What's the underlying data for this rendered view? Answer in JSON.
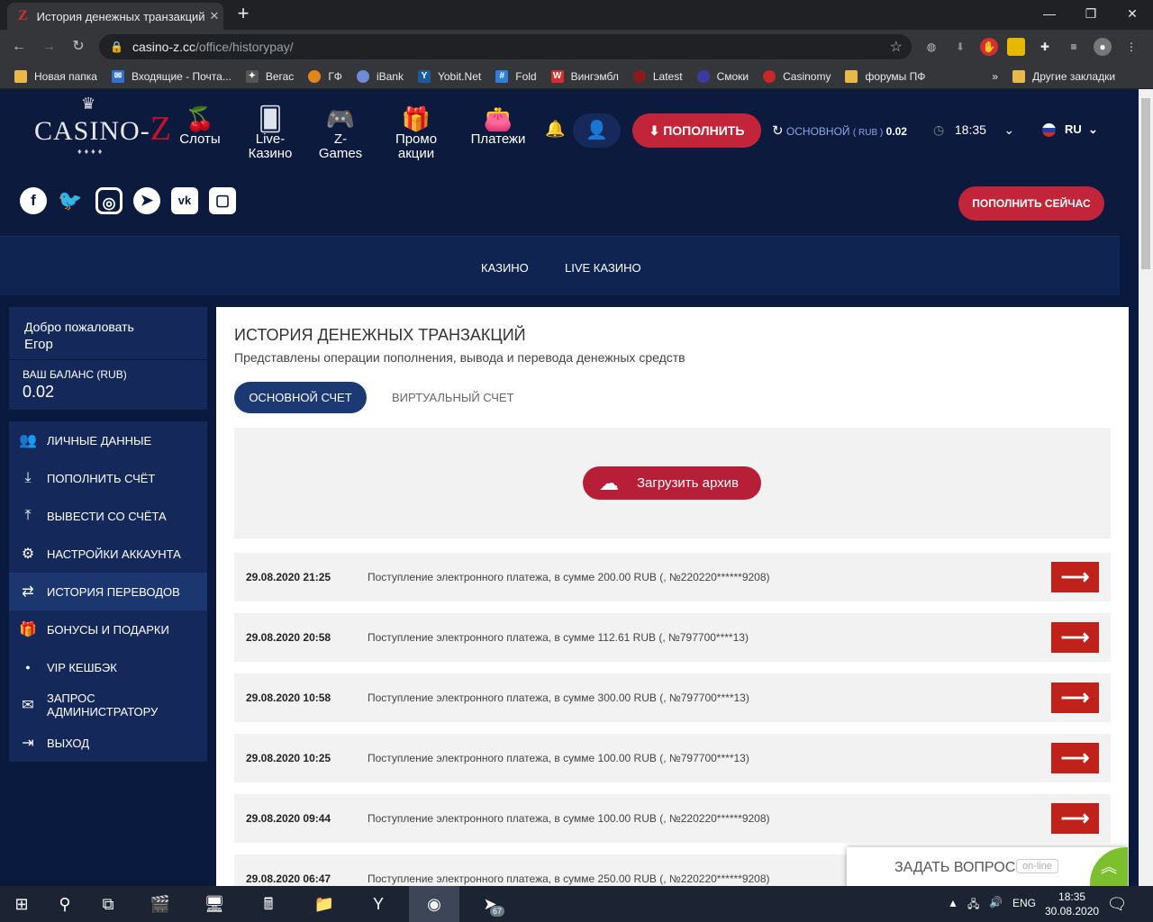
{
  "browser": {
    "tab_title": "История денежных транзакций",
    "tab_favicon": "Z",
    "url_host": "casino-z.cc",
    "url_path": "/office/historypay/",
    "bookmarks": [
      "Новая папка",
      "Входящие - Почта...",
      "Вегас",
      "ГФ",
      "iBank",
      "Yobit.Net",
      "Fold",
      "Вингэмбл",
      "Latest",
      "Смоки",
      "Casinomy",
      "форумы ПФ"
    ],
    "bookmarks_more": "»",
    "other_bookmarks": "Другие закладки"
  },
  "header": {
    "logo_text_left": "CASINO",
    "logo_text_z": "Z",
    "nav": [
      {
        "label": "Слоты",
        "icon": "cherry-icon"
      },
      {
        "label": "Live-\nКазино",
        "icon": "cards-icon"
      },
      {
        "label": "Z-\nGames",
        "icon": "gamepad-icon"
      },
      {
        "label": "Промо\nакции",
        "icon": "gift-icon"
      },
      {
        "label": "Платежи",
        "icon": "wallet-icon"
      }
    ],
    "deposit_label": "ПОПОЛНИТЬ",
    "balance_label": "ОСНОВНОЙ",
    "balance_currency": "( RUB )",
    "balance_value": "0.02",
    "time": "18:35",
    "language": "RU"
  },
  "social": {
    "icons": [
      "facebook-icon",
      "twitter-icon",
      "instagram-icon",
      "telegram-icon",
      "vk-icon",
      "chat-bubble-icon"
    ],
    "deposit_now_label": "ПОПОЛНИТЬ СЕЙЧАС"
  },
  "game_nav": [
    "КАЗИНО",
    "LIVE КАЗИНО"
  ],
  "sidebar": {
    "welcome": "Добро пожаловать",
    "username": "Егор",
    "balance_label": "ВАШ БАЛАНС (RUB)",
    "balance_value": "0.02",
    "menu": [
      {
        "label": "ЛИЧНЫЕ ДАННЫЕ",
        "icon": "user-plus-icon"
      },
      {
        "label": "ПОПОЛНИТЬ СЧЁТ",
        "icon": "download-icon"
      },
      {
        "label": "ВЫВЕСТИ СО СЧЁТА",
        "icon": "upload-icon"
      },
      {
        "label": "НАСТРОЙКИ АККАУНТА",
        "icon": "gears-icon"
      },
      {
        "label": "ИСТОРИЯ ПЕРЕВОДОВ",
        "icon": "exchange-icon",
        "active": true
      },
      {
        "label": "БОНУСЫ И ПОДАРКИ",
        "icon": "gift-hand-icon"
      },
      {
        "label": "VIP КЕШБЭК",
        "icon": "bullet-icon"
      },
      {
        "label": "ЗАПРОС\nАДМИНИСТРАТОРУ",
        "icon": "envelope-icon"
      },
      {
        "label": "ВЫХОД",
        "icon": "sign-out-icon"
      }
    ]
  },
  "main": {
    "title": "ИСТОРИЯ ДЕНЕЖНЫХ ТРАНЗАКЦИЙ",
    "subtitle": "Представлены операции пополнения, вывода и перевода денежных средств",
    "tab_main": "ОСНОВНОЙ СЧЕТ",
    "tab_virtual": "ВИРТУАЛЬНЫЙ СЧЕТ",
    "archive_button": "Загрузить архив",
    "transactions": [
      {
        "date": "29.08.2020 21:25",
        "desc": "Поступление электронного платежа, в сумме 200.00 RUB (, №220220******9208)"
      },
      {
        "date": "29.08.2020 20:58",
        "desc": "Поступление электронного платежа, в сумме 112.61 RUB (, №797700****13)"
      },
      {
        "date": "29.08.2020 10:58",
        "desc": "Поступление электронного платежа, в сумме 300.00 RUB (, №797700****13)"
      },
      {
        "date": "29.08.2020 10:25",
        "desc": "Поступление электронного платежа, в сумме 100.00 RUB (, №797700****13)"
      },
      {
        "date": "29.08.2020 09:44",
        "desc": "Поступление электронного платежа, в сумме 100.00 RUB (, №220220******9208)"
      },
      {
        "date": "29.08.2020 06:47",
        "desc": "Поступление электронного платежа, в сумме 250.00 RUB (, №220220******9208)"
      }
    ]
  },
  "chat": {
    "label": "ЗАДАТЬ ВОПРОС",
    "status": "on-line"
  },
  "taskbar": {
    "lang": "ENG",
    "time": "18:35",
    "date": "30.08.2020",
    "telegram_badge": "67"
  },
  "colors": {
    "accent_red": "#c2243a",
    "navy": "#0b1a3d",
    "panel": "#14295a"
  }
}
